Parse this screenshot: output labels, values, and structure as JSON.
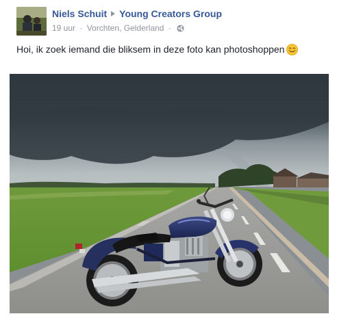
{
  "post": {
    "author": "Niels Schuit",
    "group": "Young Creators Group",
    "time": "19 uur",
    "location": "Vorchten, Gelderland",
    "separator": "·",
    "privacy_icon": "globe-icon",
    "message": "Hoi, ik zoek iemand die bliksem in deze foto kan photoshoppen",
    "emoji": "smiling-face-emoji"
  },
  "colors": {
    "link": "#365899",
    "meta": "#90949c",
    "text": "#1d2129"
  }
}
